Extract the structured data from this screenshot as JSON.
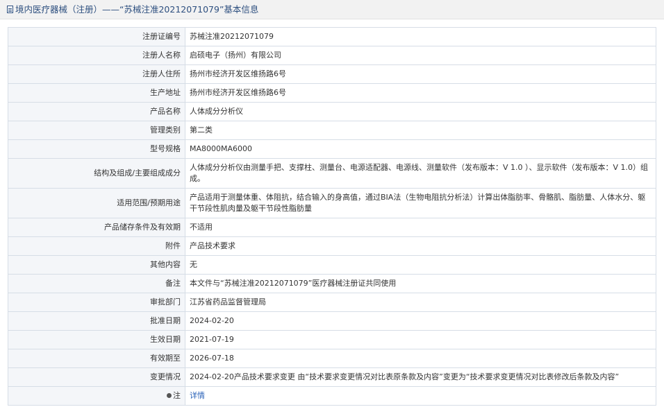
{
  "title": "境内医疗器械（注册）——“苏械注准20212071079”基本信息",
  "rows": [
    {
      "label": "注册证编号",
      "value": "苏械注准20212071079"
    },
    {
      "label": "注册人名称",
      "value": "启硕电子（扬州）有限公司"
    },
    {
      "label": "注册人住所",
      "value": "扬州市经济开发区维扬路6号"
    },
    {
      "label": "生产地址",
      "value": "扬州市经济开发区维扬路6号"
    },
    {
      "label": "产品名称",
      "value": "人体成分分析仪"
    },
    {
      "label": "管理类别",
      "value": "第二类"
    },
    {
      "label": "型号规格",
      "value": "MA8000MA6000"
    },
    {
      "label": "结构及组成/主要组成成分",
      "value": "人体成分分析仪由测量手把、支撑柱、测量台、电源适配器、电源线、测量软件（发布版本：V 1.0 ）、显示软件（发布版本：V 1.0）组成。"
    },
    {
      "label": "适用范围/预期用途",
      "value": "产品适用于测量体重、体阻抗，结合输入的身高值，通过BIA法（生物电阻抗分析法）计算出体脂肪率、骨骼肌、脂肪量、人体水分、躯干节段性肌肉量及躯干节段性脂肪量"
    },
    {
      "label": "产品储存条件及有效期",
      "value": "不适用"
    },
    {
      "label": "附件",
      "value": "产品技术要求"
    },
    {
      "label": "其他内容",
      "value": "无"
    },
    {
      "label": "备注",
      "value": "本文件与“苏械注准20212071079”医疗器械注册证共同使用"
    },
    {
      "label": "审批部门",
      "value": "江苏省药品监督管理局"
    },
    {
      "label": "批准日期",
      "value": "2024-02-20"
    },
    {
      "label": "生效日期",
      "value": "2021-07-19"
    },
    {
      "label": "有效期至",
      "value": "2026-07-18"
    },
    {
      "label": "变更情况",
      "value": "2024-02-20产品技术要求变更 由“技术要求变更情况对比表原条款及内容”变更为“技术要求变更情况对比表修改后条款及内容”"
    }
  ],
  "note": {
    "label": "注",
    "link": "详情",
    "icon": "bulb-icon"
  }
}
